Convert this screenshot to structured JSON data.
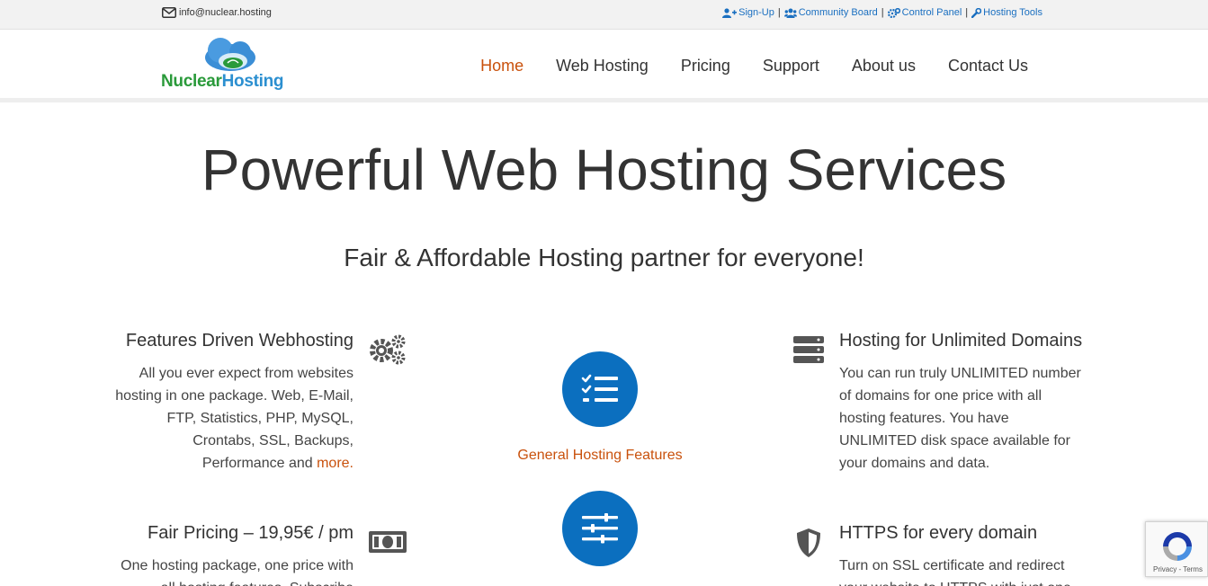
{
  "topbar": {
    "email": "info@nuclear.hosting",
    "links": [
      {
        "label": "Sign-Up",
        "icon": "user-plus-icon"
      },
      {
        "label": "Community Board",
        "icon": "users-icon"
      },
      {
        "label": "Control Panel",
        "icon": "cogs-icon"
      },
      {
        "label": "Hosting Tools",
        "icon": "wrench-icon"
      }
    ],
    "separator": "|"
  },
  "logo": {
    "part1": "Nuclear",
    "part2": "Hosting"
  },
  "nav": {
    "items": [
      {
        "label": "Home",
        "active": true
      },
      {
        "label": "Web Hosting"
      },
      {
        "label": "Pricing"
      },
      {
        "label": "Support"
      },
      {
        "label": "About us"
      },
      {
        "label": "Contact Us"
      }
    ]
  },
  "hero": {
    "title": "Powerful Web Hosting Services",
    "subtitle": "Fair & Affordable Hosting partner for everyone!"
  },
  "features": {
    "left": [
      {
        "title": "Features Driven Webhosting",
        "text": "All you ever expect from websites hosting in one package. Web, E-Mail, FTP, Statistics, PHP, MySQL, Crontabs, SSL, Backups, Performance and",
        "link": "more."
      },
      {
        "title": "Fair Pricing – 19,95€ / pm",
        "text": "One hosting package, one price with all hosting features. Subscribe"
      }
    ],
    "right": [
      {
        "title": "Hosting for Unlimited Domains",
        "text": "You can run truly UNLIMITED number of domains for one price with all hosting features. You have UNLIMITED disk space available for your domains and data."
      },
      {
        "title": "HTTPS for every domain",
        "text": "Turn on SSL certificate and redirect your website to HTTPS with just one"
      }
    ],
    "center_label": "General Hosting Features"
  },
  "recaptcha": {
    "text": "Privacy - Terms"
  },
  "colors": {
    "accent": "#c9510c",
    "primary": "#0b6fbf",
    "link": "#1a6fc0"
  }
}
